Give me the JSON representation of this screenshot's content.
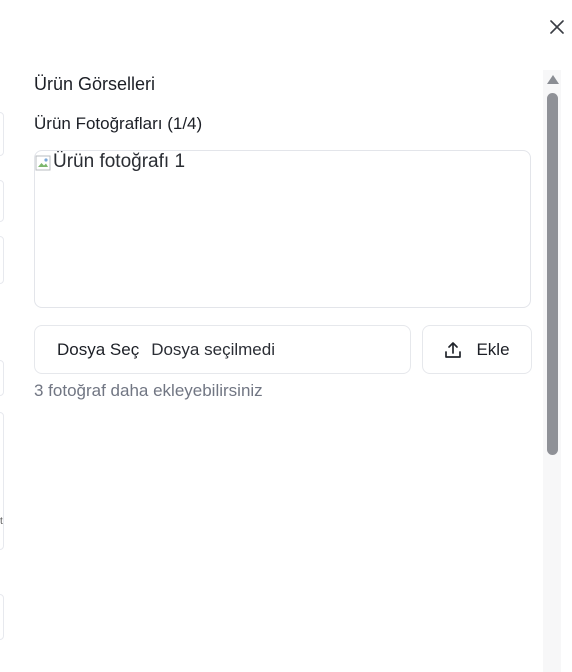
{
  "dialog": {
    "section_title": "Ürün Görselleri",
    "photos_label": "Ürün Fotoğrafları (1/4)",
    "photos": [
      {
        "alt": "Ürün fotoğrafı 1"
      }
    ],
    "file_input": {
      "button_label": "Dosya Seç",
      "status": "Dosya seçilmedi"
    },
    "add_button": {
      "label": "Ekle",
      "icon": "upload-icon"
    },
    "hint": "3 fotoğraf daha ekleyebilirsiniz",
    "close_icon": "close-icon"
  },
  "background": {
    "partial_mark": "t"
  },
  "colors": {
    "text": "#1c1f26",
    "muted": "#717683",
    "border": "#e3e5ea",
    "scroll_thumb": "#8f9197"
  }
}
